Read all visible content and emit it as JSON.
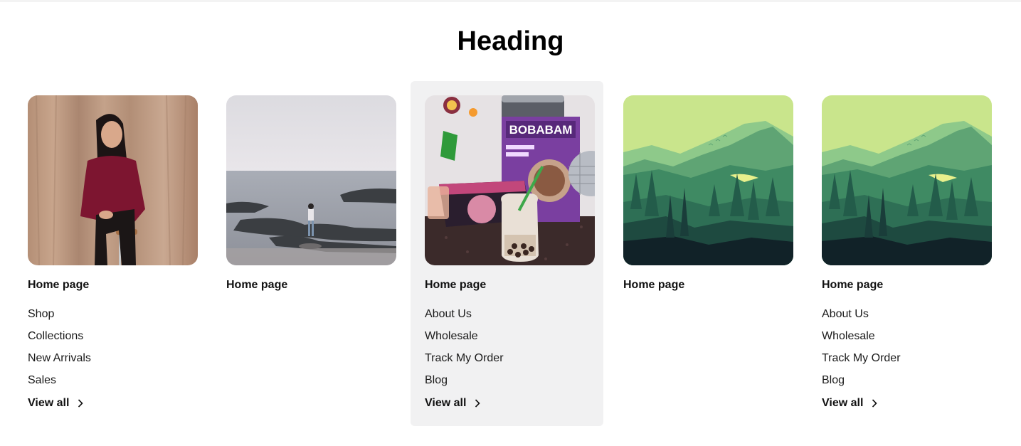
{
  "heading": "Heading",
  "cards": [
    {
      "title": "Home page",
      "image": "woman-seated-on-stool-photo",
      "links": [
        "Shop",
        "Collections",
        "New Arrivals",
        "Sales"
      ],
      "view_all": "View all"
    },
    {
      "title": "Home page",
      "image": "rocky-seashore-photo",
      "links": [],
      "view_all": ""
    },
    {
      "title": "Home page",
      "image": "boba-drink-kit-photo",
      "links": [
        "About Us",
        "Wholesale",
        "Track My Order",
        "Blog"
      ],
      "view_all": "View all",
      "highlighted": true
    },
    {
      "title": "Home page",
      "image": "forest-mountain-illustration",
      "links": [],
      "view_all": ""
    },
    {
      "title": "Home page",
      "image": "forest-mountain-illustration",
      "links": [
        "About Us",
        "Wholesale",
        "Track My Order",
        "Blog"
      ],
      "view_all": "View all"
    }
  ],
  "product_label": "BOBABAM",
  "colors": {
    "highlight_bg": "#f1f1f2",
    "text": "#111111"
  }
}
